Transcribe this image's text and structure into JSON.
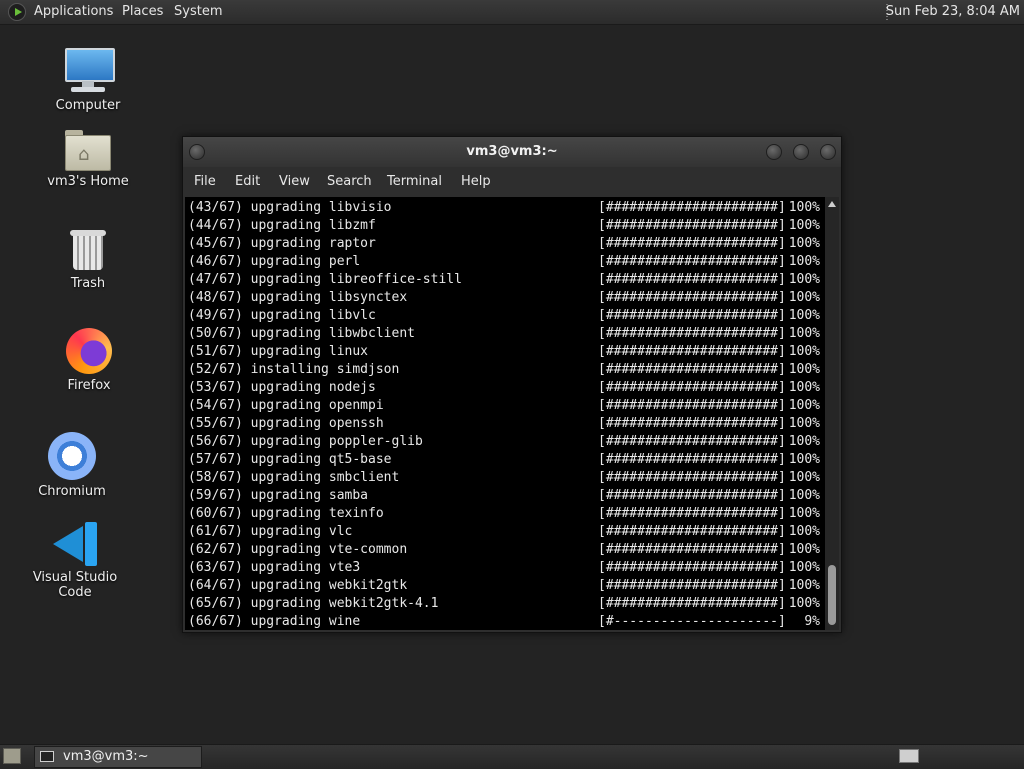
{
  "top_panel": {
    "menus": [
      "Applications",
      "Places",
      "System"
    ],
    "clock": "Sun Feb 23,  8:04 AM",
    "icon": "applications-icon"
  },
  "desktop_icons": [
    {
      "label": "Computer",
      "icon": "computer-icon"
    },
    {
      "label": "vm3's Home",
      "icon": "home-folder-icon"
    },
    {
      "label": "Trash",
      "icon": "trash-icon"
    },
    {
      "label": "Firefox",
      "icon": "firefox-icon"
    },
    {
      "label": "Chromium",
      "icon": "chromium-icon"
    },
    {
      "label": "Visual Studio Code",
      "icon": "vscode-icon"
    }
  ],
  "window": {
    "title": "vm3@vm3:~",
    "menu": [
      "File",
      "Edit",
      "View",
      "Search",
      "Terminal",
      "Help"
    ]
  },
  "terminal_lines": [
    {
      "text": "(43/67) upgrading libvisio",
      "bar": "[######################]",
      "pct": "100%"
    },
    {
      "text": "(44/67) upgrading libzmf",
      "bar": "[######################]",
      "pct": "100%"
    },
    {
      "text": "(45/67) upgrading raptor",
      "bar": "[######################]",
      "pct": "100%"
    },
    {
      "text": "(46/67) upgrading perl",
      "bar": "[######################]",
      "pct": "100%"
    },
    {
      "text": "(47/67) upgrading libreoffice-still",
      "bar": "[######################]",
      "pct": "100%"
    },
    {
      "text": "(48/67) upgrading libsynctex",
      "bar": "[######################]",
      "pct": "100%"
    },
    {
      "text": "(49/67) upgrading libvlc",
      "bar": "[######################]",
      "pct": "100%"
    },
    {
      "text": "(50/67) upgrading libwbclient",
      "bar": "[######################]",
      "pct": "100%"
    },
    {
      "text": "(51/67) upgrading linux",
      "bar": "[######################]",
      "pct": "100%"
    },
    {
      "text": "(52/67) installing simdjson",
      "bar": "[######################]",
      "pct": "100%"
    },
    {
      "text": "(53/67) upgrading nodejs",
      "bar": "[######################]",
      "pct": "100%"
    },
    {
      "text": "(54/67) upgrading openmpi",
      "bar": "[######################]",
      "pct": "100%"
    },
    {
      "text": "(55/67) upgrading openssh",
      "bar": "[######################]",
      "pct": "100%"
    },
    {
      "text": "(56/67) upgrading poppler-glib",
      "bar": "[######################]",
      "pct": "100%"
    },
    {
      "text": "(57/67) upgrading qt5-base",
      "bar": "[######################]",
      "pct": "100%"
    },
    {
      "text": "(58/67) upgrading smbclient",
      "bar": "[######################]",
      "pct": "100%"
    },
    {
      "text": "(59/67) upgrading samba",
      "bar": "[######################]",
      "pct": "100%"
    },
    {
      "text": "(60/67) upgrading texinfo",
      "bar": "[######################]",
      "pct": "100%"
    },
    {
      "text": "(61/67) upgrading vlc",
      "bar": "[######################]",
      "pct": "100%"
    },
    {
      "text": "(62/67) upgrading vte-common",
      "bar": "[######################]",
      "pct": "100%"
    },
    {
      "text": "(63/67) upgrading vte3",
      "bar": "[######################]",
      "pct": "100%"
    },
    {
      "text": "(64/67) upgrading webkit2gtk",
      "bar": "[######################]",
      "pct": "100%"
    },
    {
      "text": "(65/67) upgrading webkit2gtk-4.1",
      "bar": "[######################]",
      "pct": "100%"
    },
    {
      "text": "(66/67) upgrading wine",
      "bar": "[#---------------------]",
      "pct": "9%"
    }
  ],
  "taskbar": {
    "task_label": "vm3@vm3:~"
  }
}
